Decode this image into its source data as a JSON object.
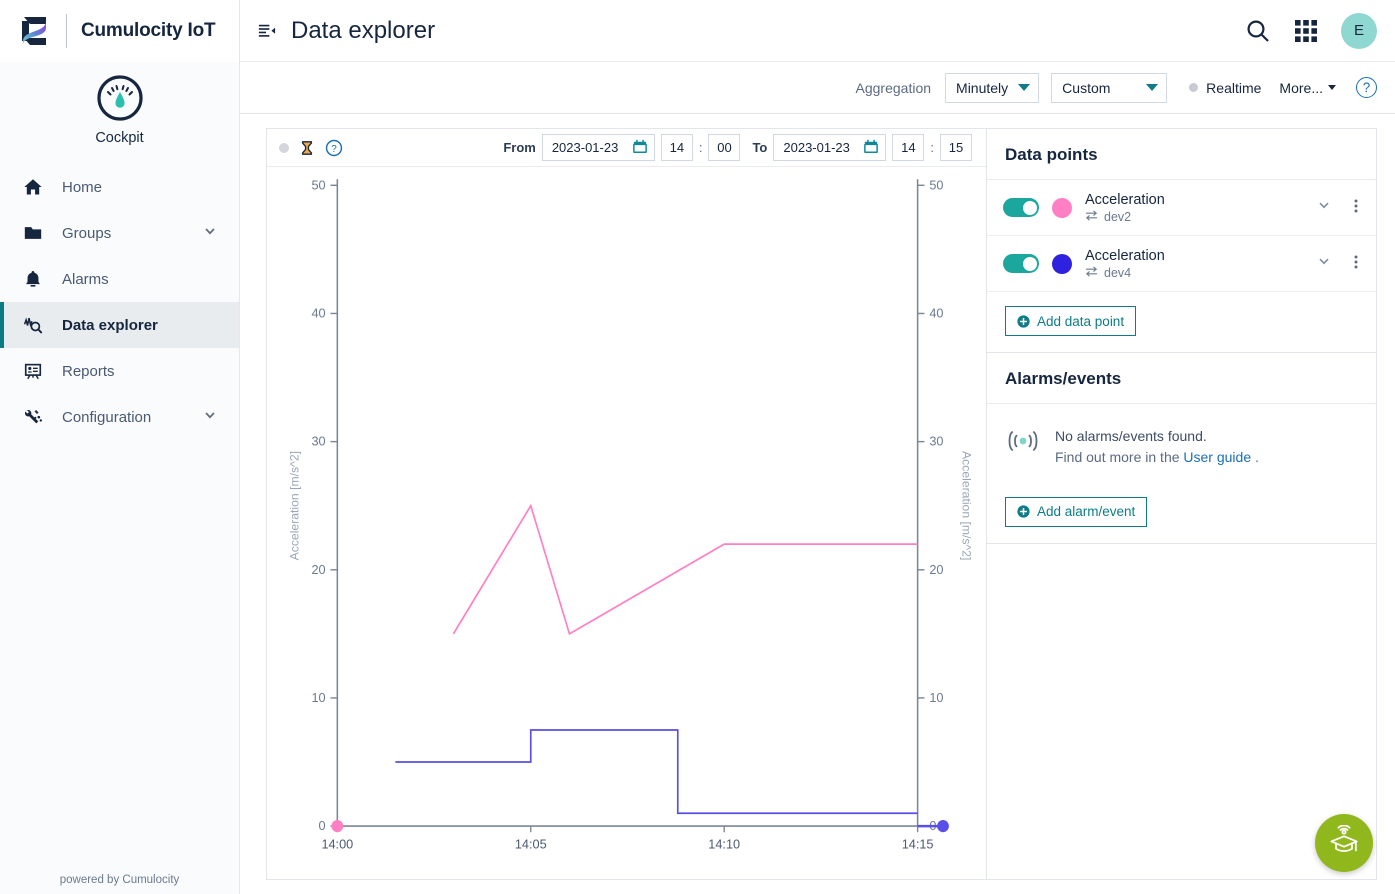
{
  "brand": {
    "title": "Cumulocity IoT",
    "logo_icon": "cumulocity-logo-icon"
  },
  "app_badge": {
    "label": "Cockpit",
    "icon": "gauge-icon"
  },
  "sidebar": {
    "items": [
      {
        "label": "Home",
        "icon": "home-icon",
        "expandable": false,
        "active": false
      },
      {
        "label": "Groups",
        "icon": "folder-icon",
        "expandable": true,
        "active": false
      },
      {
        "label": "Alarms",
        "icon": "bell-icon",
        "expandable": false,
        "active": false
      },
      {
        "label": "Data explorer",
        "icon": "data-explorer-icon",
        "expandable": false,
        "active": true
      },
      {
        "label": "Reports",
        "icon": "reports-icon",
        "expandable": false,
        "active": false
      },
      {
        "label": "Configuration",
        "icon": "configuration-icon",
        "expandable": true,
        "active": false
      }
    ],
    "footer": "powered by Cumulocity"
  },
  "header": {
    "title": "Data explorer",
    "title_icon": "collapse-menu-icon",
    "search_icon": "search-icon",
    "apps_icon": "app-switcher-grid-icon",
    "avatar_initial": "E"
  },
  "toolbar": {
    "aggregation_label": "Aggregation",
    "aggregation_value": "Minutely",
    "range_value": "Custom",
    "realtime_label": "Realtime",
    "realtime_active": false,
    "more_label": "More...",
    "help_icon": "help-circle-icon"
  },
  "chart_header": {
    "status_dot": "idle-dot",
    "hourglass_icon": "hourglass-icon",
    "help_icon": "help-circle-icon",
    "from_label": "From",
    "from_date": "2023-01-23",
    "from_hour": "14",
    "from_minute": "00",
    "to_label": "To",
    "to_date": "2023-01-23",
    "to_hour": "14",
    "to_minute": "15",
    "calendar_icon": "calendar-icon",
    "time_separator": ":"
  },
  "data_points": {
    "title": "Data points",
    "items": [
      {
        "name": "Acceleration",
        "device": "dev2",
        "color": "#ff7fc4",
        "enabled": true,
        "device_icon": "device-transfer-icon",
        "chevron_icon": "chevron-down-icon",
        "menu_icon": "kebab-menu-icon"
      },
      {
        "name": "Acceleration",
        "device": "dev4",
        "color": "#2f22df",
        "enabled": true,
        "device_icon": "device-transfer-icon",
        "chevron_icon": "chevron-down-icon",
        "menu_icon": "kebab-menu-icon"
      }
    ],
    "add_label": "Add data point"
  },
  "alarms": {
    "title": "Alarms/events",
    "empty_icon": "signal-waves-icon",
    "empty_title": "No alarms/events found.",
    "empty_hint_prefix": "Find out more in the ",
    "empty_hint_link": "User guide",
    "empty_hint_suffix": ".",
    "add_label": "Add alarm/event"
  },
  "fab": {
    "icon": "academy-graduation-cap-icon",
    "color": "#90b81c"
  },
  "colors": {
    "accent_teal": "#0d7c88",
    "toggle_on": "#1ca79e",
    "series_pink": "#ff7fc4",
    "series_blue": "#2f22df",
    "link_blue": "#1a6fb5",
    "nav_active_bg": "#e9ecef",
    "brand_dark": "#16263f"
  },
  "chart_data": {
    "type": "line",
    "title": "",
    "xlabel": "",
    "ylabel": "Acceleration [m/s^2]",
    "y2label": "Acceleration [m/s^2]",
    "ylim": [
      0,
      50
    ],
    "y2lim": [
      0,
      50
    ],
    "yticks": [
      0,
      10,
      20,
      30,
      40,
      50
    ],
    "y2ticks": [
      0,
      10,
      20,
      30,
      40,
      50
    ],
    "xlim": [
      "14:00",
      "14:15"
    ],
    "xticks": [
      "14:00",
      "14:05",
      "14:10",
      "14:15"
    ],
    "grid": false,
    "legend": "none",
    "series": [
      {
        "name": "Acceleration dev2",
        "color": "#ff7fc4",
        "axis": "left",
        "interpolation": "linear",
        "x": [
          "14:03",
          "14:05",
          "14:06",
          "14:10",
          "14:15"
        ],
        "y": [
          15,
          25,
          15,
          22,
          22
        ],
        "marker_start": {
          "x": "14:00",
          "y": 0
        }
      },
      {
        "name": "Acceleration dev4",
        "color": "#5a4ee8",
        "axis": "left",
        "interpolation": "step",
        "x": [
          "14:01.5",
          "14:05",
          "14:08.8",
          "14:15"
        ],
        "y": [
          5,
          7.5,
          1,
          1
        ],
        "marker_end": {
          "x": "14:15",
          "y": 0
        }
      }
    ]
  }
}
